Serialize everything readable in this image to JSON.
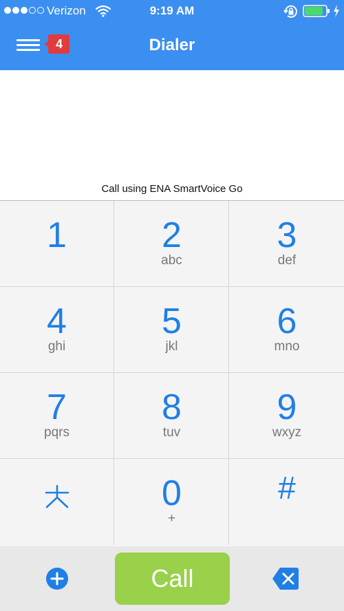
{
  "status_bar": {
    "carrier": "Verizon",
    "time": "9:19 AM",
    "signal_bars_filled": 3,
    "signal_bars_total": 5,
    "battery_level": 0.8,
    "battery_color": "#4cd964",
    "charging": true
  },
  "header": {
    "title": "Dialer",
    "menu_icon": "hamburger-menu-icon",
    "notification_count": "4",
    "header_color": "#3b8ff0",
    "badge_color": "#e23b3b"
  },
  "display": {
    "number": "",
    "call_using_text": "Call using ENA SmartVoice Go"
  },
  "keypad": {
    "digit_color": "#1f7fe6",
    "keys": [
      {
        "digit": "1",
        "letters": ""
      },
      {
        "digit": "2",
        "letters": "abc"
      },
      {
        "digit": "3",
        "letters": "def"
      },
      {
        "digit": "4",
        "letters": "ghi"
      },
      {
        "digit": "5",
        "letters": "jkl"
      },
      {
        "digit": "6",
        "letters": "mno"
      },
      {
        "digit": "7",
        "letters": "pqrs"
      },
      {
        "digit": "8",
        "letters": "tuv"
      },
      {
        "digit": "9",
        "letters": "wxyz"
      },
      {
        "digit": "*",
        "letters": ""
      },
      {
        "digit": "0",
        "letters": "+"
      },
      {
        "digit": "#",
        "letters": ""
      }
    ]
  },
  "bottom_bar": {
    "add_icon": "add-contact-icon",
    "call_label": "Call",
    "call_color": "#99d14a",
    "backspace_icon": "backspace-icon"
  }
}
